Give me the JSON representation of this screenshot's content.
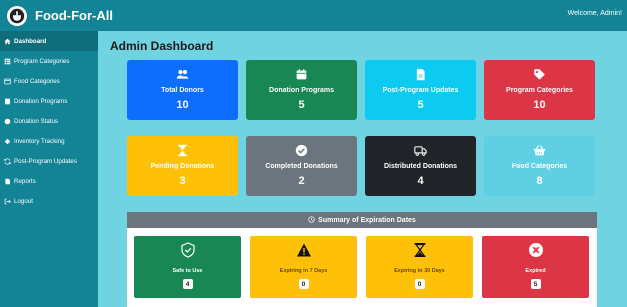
{
  "header": {
    "brand": "Food-For-All",
    "welcome": "Welcome, Admin!"
  },
  "sidebar": {
    "items": [
      {
        "label": "Dashboard",
        "icon": "home-icon",
        "active": true
      },
      {
        "label": "Program Categories",
        "icon": "table-icon"
      },
      {
        "label": "Food Categories",
        "icon": "window-icon"
      },
      {
        "label": "Donation Programs",
        "icon": "book-icon"
      },
      {
        "label": "Donation Status",
        "icon": "circle-icon"
      },
      {
        "label": "Inventory Tracking",
        "icon": "diamond-icon"
      },
      {
        "label": "Post-Program Updates",
        "icon": "sync-icon"
      },
      {
        "label": "Reports",
        "icon": "file-icon"
      },
      {
        "label": "Logout",
        "icon": "logout-icon"
      }
    ]
  },
  "main": {
    "title": "Admin Dashboard",
    "cards": [
      {
        "label": "Total Donors",
        "value": "10",
        "color": "#0d6efd",
        "icon": "users-icon"
      },
      {
        "label": "Donation Programs",
        "value": "5",
        "color": "#198754",
        "icon": "calendar-icon"
      },
      {
        "label": "Post-Program Updates",
        "value": "5",
        "color": "#0dcaf0",
        "icon": "file-icon"
      },
      {
        "label": "Program Categories",
        "value": "10",
        "color": "#dc3545",
        "icon": "tag-icon"
      },
      {
        "label": "Pending Donations",
        "value": "3",
        "color": "#ffc107",
        "icon": "hourglass-icon"
      },
      {
        "label": "Completed Donations",
        "value": "2",
        "color": "#6c757d",
        "icon": "check-circle-icon"
      },
      {
        "label": "Distributed Donations",
        "value": "4",
        "color": "#212529",
        "icon": "truck-icon"
      },
      {
        "label": "Food Categories",
        "value": "8",
        "color": "#5fd0e4",
        "icon": "basket-icon"
      }
    ]
  },
  "summary": {
    "title": "Summary of Expiration Dates",
    "cards": [
      {
        "label": "Safe to Use",
        "value": "4",
        "color": "#198754",
        "icon": "shield-check-icon"
      },
      {
        "label": "Expiring in 7 Days",
        "value": "0",
        "color": "#ffc107",
        "icon": "warning-icon"
      },
      {
        "label": "Expiring in 30 Days",
        "value": "0",
        "color": "#ffc107",
        "icon": "hourglass-icon"
      },
      {
        "label": "Expired",
        "value": "5",
        "color": "#dc3545",
        "icon": "x-circle-icon"
      }
    ]
  }
}
